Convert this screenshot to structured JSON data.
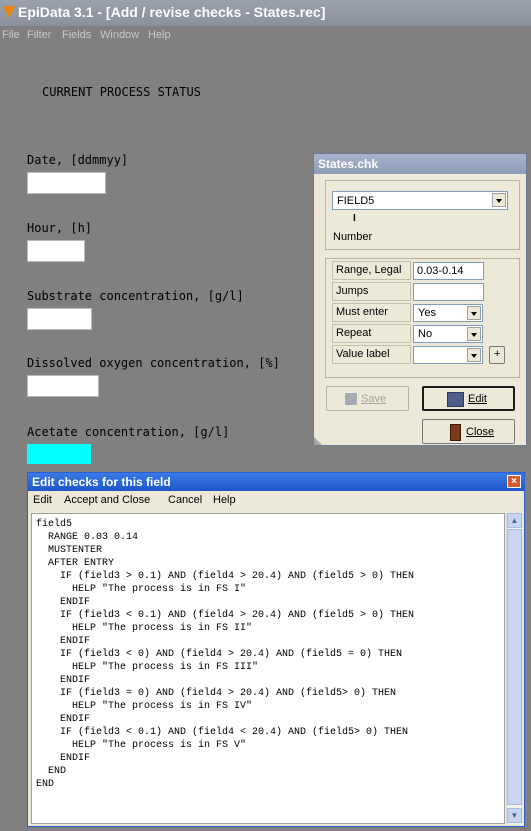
{
  "app": {
    "title": "EpiData 3.1 - [Add / revise checks - States.rec]",
    "menu": [
      "File",
      "Filter",
      "Fields",
      "Window",
      "Help"
    ]
  },
  "form": {
    "heading": "CURRENT PROCESS STATUS",
    "fields": [
      {
        "label": "Date, [ddmmyy]",
        "value": ""
      },
      {
        "label": "Hour, [h]",
        "value": ""
      },
      {
        "label": "Substrate concentration,  [g/l]",
        "value": ""
      },
      {
        "label": "Dissolved oxygen concentration, [%]",
        "value": ""
      },
      {
        "label": "Acetate concentration, [g/l]",
        "value": ""
      }
    ],
    "active_field_color": "#00ffff"
  },
  "chk_dialog": {
    "title": "States.chk",
    "field_select": "FIELD5",
    "field_type_marker": "I",
    "field_type": "Number",
    "props": [
      {
        "label": "Range, Legal",
        "value": "0.03-0.14"
      },
      {
        "label": "Jumps",
        "value": ""
      },
      {
        "label": "Must enter",
        "value": "Yes"
      },
      {
        "label": "Repeat",
        "value": "No"
      },
      {
        "label": "Value label",
        "value": ""
      }
    ],
    "plus_label": "+",
    "save_label": "Save",
    "edit_label": "Edit",
    "close_label": "Close"
  },
  "edit_window": {
    "title": "Edit checks for this field",
    "close_glyph": "×",
    "menu": [
      "Edit",
      "Accept and Close",
      "Cancel",
      "Help"
    ],
    "code": "field5\n  RANGE 0.03 0.14\n  MUSTENTER\n  AFTER ENTRY\n    IF (field3 > 0.1) AND (field4 > 20.4) AND (field5 > 0) THEN\n      HELP \"The process is in FS I\"\n    ENDIF\n    IF (field3 < 0.1) AND (field4 > 20.4) AND (field5 > 0) THEN\n      HELP \"The process is in FS II\"\n    ENDIF\n    IF (field3 < 0) AND (field4 > 20.4) AND (field5 = 0) THEN\n      HELP \"The process is in FS III\"\n    ENDIF\n    IF (field3 = 0) AND (field4 > 20.4) AND (field5> 0) THEN\n      HELP \"The process is in FS IV\"\n    ENDIF\n    IF (field3 < 0.1) AND (field4 < 20.4) AND (field5> 0) THEN\n      HELP \"The process is in FS V\"\n    ENDIF\n  END\nEND"
  }
}
